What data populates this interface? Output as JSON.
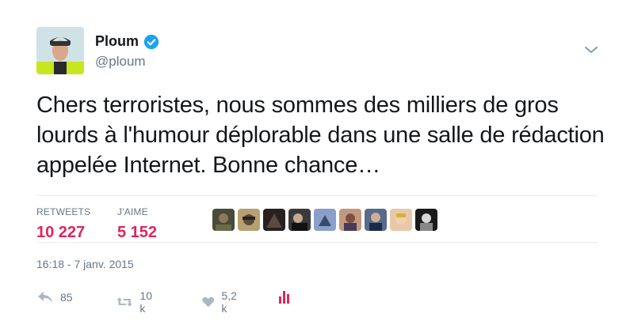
{
  "author": {
    "display_name": "Ploum",
    "handle": "@ploum",
    "verified": true
  },
  "tweet_text": "Chers terroristes, nous sommes des milliers de gros lourds à l'humour déplorable dans une salle de rédaction appelée Internet. Bonne chance…",
  "stats": {
    "retweets_label": "RETWEETS",
    "retweets_value": "10 227",
    "likes_label": "J'AIME",
    "likes_value": "5 152"
  },
  "likers_count_shown": 9,
  "timestamp": "16:18 - 7 janv. 2015",
  "actions": {
    "reply_count": "85",
    "retweet_count": "10 k",
    "like_count": "5,2 k"
  },
  "colors": {
    "accent_red": "#e0245e",
    "verified_blue": "#1da1f2",
    "muted_gray": "#657786",
    "analytics_red": "#e0245e"
  },
  "icons": [
    "verified-badge-icon",
    "chevron-down-icon",
    "reply-icon",
    "retweet-icon",
    "heart-icon",
    "analytics-icon"
  ]
}
